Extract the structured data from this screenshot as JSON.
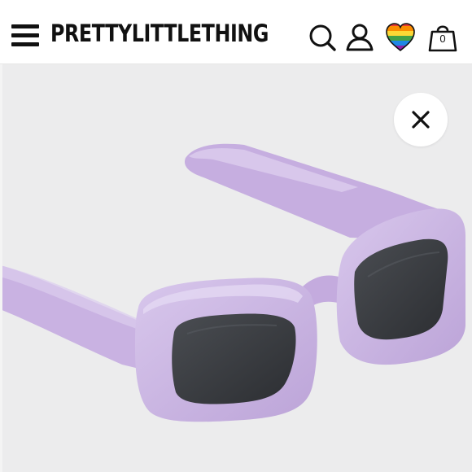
{
  "header": {
    "brand": "PRETTYLITTLETHING",
    "bag_count": "0",
    "icons": [
      "menu-icon",
      "search-icon",
      "account-icon",
      "rainbow-heart-icon",
      "bag-icon"
    ]
  },
  "product_image": {
    "subject": "lilac rectangular sunglasses",
    "frame_color": "#c9b3e0",
    "lens_color": "#3a3d42"
  },
  "overlay": {
    "close_icon": "close-icon"
  }
}
